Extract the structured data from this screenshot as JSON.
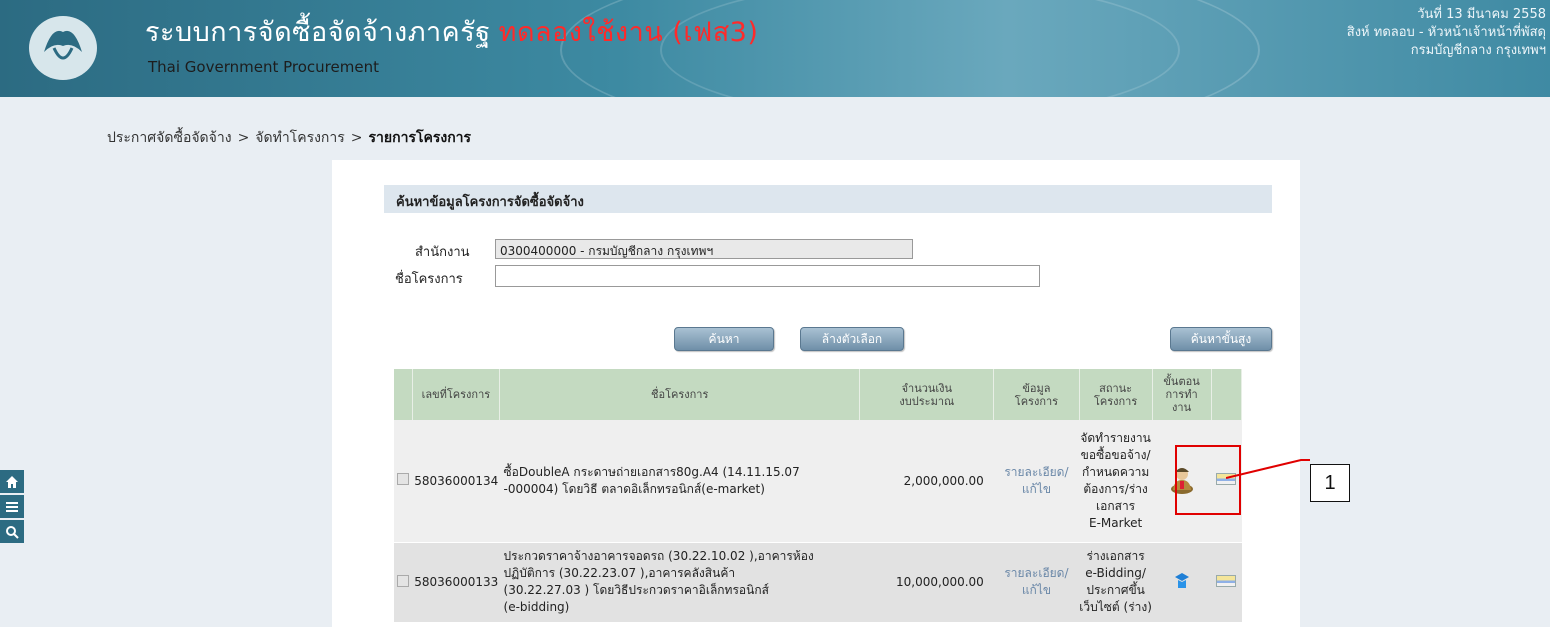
{
  "header": {
    "title": "ระบบการจัดซื้อจัดจ้างภาครัฐ",
    "trial_badge": "ทดลองใช้งาน (เฟส3)",
    "subtitle": "Thai Government Procurement",
    "date": "วันที่ 13 มีนาคม 2558",
    "user": "สิงห์ ทดลอบ - หัวหน้าเจ้าหน้าที่พัสดุ",
    "department": "กรมบัญชีกลาง กรุงเทพฯ"
  },
  "breadcrumb": {
    "items": [
      "ประกาศจัดซื้อจัดจ้าง",
      "จัดทำโครงการ"
    ],
    "separator": ">",
    "current": "รายการโครงการ"
  },
  "side_menu": {
    "icons": [
      "home-icon",
      "menu-icon",
      "search-icon"
    ]
  },
  "search": {
    "section_title": "ค้นหาข้อมูลโครงการจัดซื้อจัดจ้าง",
    "dept_label": "สำนักงาน",
    "dept_value": "0300400000 - กรมบัญชีกลาง กรุงเทพฯ",
    "project_label": "ชื่อโครงการ",
    "project_value": "",
    "search_button": "ค้นหา",
    "clear_button": "ล้างตัวเลือก",
    "advanced_button": "ค้นหาขั้นสูง"
  },
  "table": {
    "headers": {
      "number": "เลขที่โครงการ",
      "name": "ชื่อโครงการ",
      "budget_1": "จำนวนเงิน",
      "budget_2": "งบประมาณ",
      "info_1": "ข้อมูล",
      "info_2": "โครงการ",
      "status_1": "สถานะ",
      "status_2": "โครงการ",
      "step_1": "ขั้นตอน",
      "step_2": "การทำ",
      "step_3": "งาน"
    },
    "rows": [
      {
        "number": "58036000134",
        "name_1": "ซื้อDoubleA กระดาษถ่ายเอกสาร80g.A4 (14.11.15.07",
        "name_2": "-000004) โดยวิธี ตลาดอิเล็กทรอนิกส์(e-market)",
        "amount": "2,000,000.00",
        "info_1": "รายละเอียด/",
        "info_2": "แก้ไข",
        "status": [
          "จัดทำรายงาน",
          "ขอซื้อขอจ้าง/",
          "กำหนดความ",
          "ต้องการ/ร่าง",
          "เอกสาร",
          "E-Market"
        ]
      },
      {
        "number": "58036000133",
        "name_1": "ประกวดราคาจ้างอาคารจอดรถ (30.22.10.02 ),อาคารห้อง",
        "name_2": "ปฏิบัติการ (30.22.23.07 ),อาคารคลังสินค้า",
        "name_3": "(30.22.27.03 ) โดยวิธีประกวดราคาอิเล็กทรอนิกส์",
        "name_4": "(e-bidding)",
        "amount": "10,000,000.00",
        "info_1": "รายละเอียด/",
        "info_2": "แก้ไข",
        "status": [
          "ร่างเอกสาร",
          "e-Bidding/",
          "ประกาศขึ้น",
          "เว็บไซต์ (ร่าง)"
        ]
      }
    ]
  },
  "annotation": {
    "label": "1"
  },
  "colors": {
    "header": "#3d8aa2",
    "accent_red": "#e00000",
    "table_header": "#c4dac1"
  }
}
